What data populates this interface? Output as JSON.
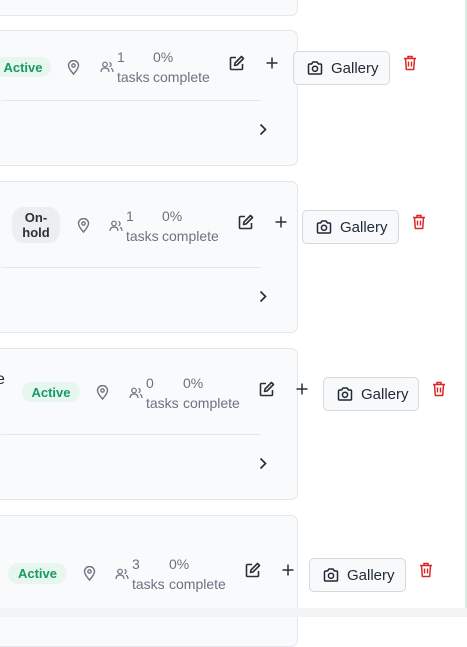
{
  "projects": [
    {
      "status": "Active",
      "tasks_count": "1",
      "tasks_word": "tasks",
      "percent": "0%",
      "complete_word": "complete",
      "gallery_label": "Gallery"
    },
    {
      "status": "On-\nhold",
      "tasks_count": "1",
      "tasks_word": "tasks",
      "percent": "0%",
      "complete_word": "complete",
      "gallery_label": "Gallery"
    },
    {
      "title_fragment": "e",
      "status": "Active",
      "tasks_count": "0",
      "tasks_word": "tasks",
      "percent": "0%",
      "complete_word": "complete",
      "gallery_label": "Gallery"
    },
    {
      "status": "Active",
      "tasks_count": "3",
      "tasks_word": "tasks",
      "percent": "0%",
      "complete_word": "complete",
      "gallery_label": "Gallery"
    }
  ],
  "colors": {
    "active_bg": "#e7f6ee",
    "active_text": "#1a9a63",
    "delete_red": "#dc2626"
  },
  "icons": [
    "location-pin-icon",
    "users-icon",
    "edit-icon",
    "plus-icon",
    "camera-icon",
    "trash-icon",
    "chevron-right-icon"
  ]
}
